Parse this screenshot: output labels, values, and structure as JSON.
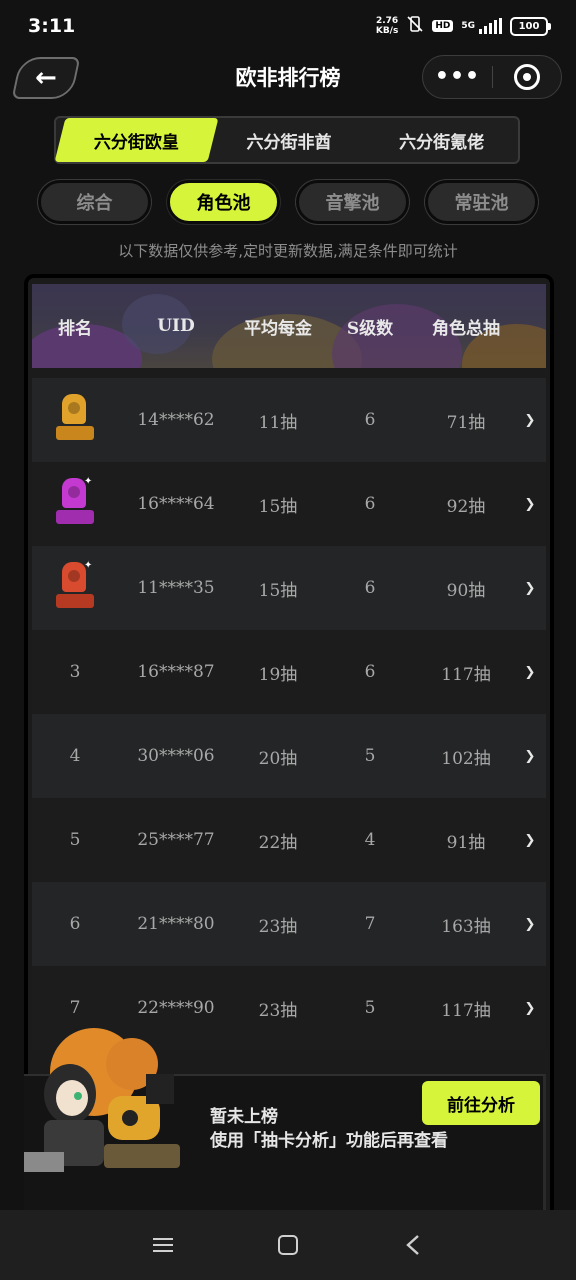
{
  "status_bar": {
    "time": "3:11",
    "net_speed_value": "2.76",
    "net_speed_unit": "KB/s",
    "hd": "HD",
    "network": "5G",
    "battery": "100"
  },
  "header": {
    "title": "欧非排行榜",
    "more_label": "•••"
  },
  "main_tabs": [
    {
      "label": "六分街欧皇",
      "active": true
    },
    {
      "label": "六分街非酋",
      "active": false
    },
    {
      "label": "六分街氪佬",
      "active": false
    }
  ],
  "sub_tabs": [
    {
      "label": "综合",
      "active": false
    },
    {
      "label": "角色池",
      "active": true
    },
    {
      "label": "音擎池",
      "active": false
    },
    {
      "label": "常驻池",
      "active": false
    }
  ],
  "notice": "以下数据仅供参考,定时更新数据,满足条件即可统计",
  "table": {
    "headers": [
      "排名",
      "UID",
      "平均每金",
      "S级数",
      "角色总抽"
    ],
    "rows": [
      {
        "rank": "1",
        "medal": "gold-medal-icon",
        "uid": "14****62",
        "avg": "11抽",
        "s_count": "6",
        "total": "71抽"
      },
      {
        "rank": "2",
        "medal": "purple-medal-icon",
        "uid": "16****64",
        "avg": "15抽",
        "s_count": "6",
        "total": "92抽"
      },
      {
        "rank": "3",
        "medal": "red-medal-icon",
        "uid": "11****35",
        "avg": "15抽",
        "s_count": "6",
        "total": "90抽"
      },
      {
        "rank": "3",
        "medal": "",
        "uid": "16****87",
        "avg": "19抽",
        "s_count": "6",
        "total": "117抽"
      },
      {
        "rank": "4",
        "medal": "",
        "uid": "30****06",
        "avg": "20抽",
        "s_count": "5",
        "total": "102抽"
      },
      {
        "rank": "5",
        "medal": "",
        "uid": "25****77",
        "avg": "22抽",
        "s_count": "4",
        "total": "91抽"
      },
      {
        "rank": "6",
        "medal": "",
        "uid": "21****80",
        "avg": "23抽",
        "s_count": "7",
        "total": "163抽"
      },
      {
        "rank": "7",
        "medal": "",
        "uid": "22****90",
        "avg": "23抽",
        "s_count": "5",
        "total": "117抽"
      }
    ]
  },
  "banner": {
    "title": "暂未上榜",
    "desc": "使用「抽卡分析」功能后再查看",
    "button": "前往分析"
  },
  "colors": {
    "accent": "#d5f43a",
    "background": "#121212",
    "gold": "#e0a22a",
    "purple": "#c43ad1",
    "red": "#d94b2f"
  }
}
